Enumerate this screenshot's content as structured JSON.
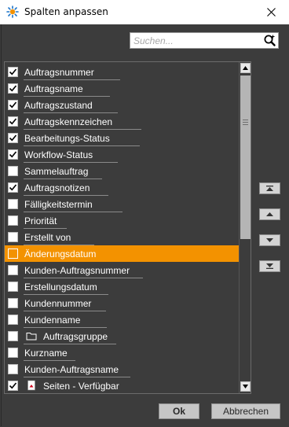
{
  "window": {
    "title": "Spalten anpassen"
  },
  "search": {
    "placeholder": "Suchen...",
    "value": ""
  },
  "list": {
    "items": [
      {
        "label": "Auftragsnummer",
        "checked": true,
        "selected": false,
        "icon": null
      },
      {
        "label": "Auftragsname",
        "checked": true,
        "selected": false,
        "icon": null
      },
      {
        "label": "Auftragszustand",
        "checked": true,
        "selected": false,
        "icon": null
      },
      {
        "label": "Auftragskennzeichen",
        "checked": true,
        "selected": false,
        "icon": null
      },
      {
        "label": "Bearbeitungs-Status",
        "checked": true,
        "selected": false,
        "icon": null
      },
      {
        "label": "Workflow-Status",
        "checked": true,
        "selected": false,
        "icon": null
      },
      {
        "label": "Sammelauftrag",
        "checked": false,
        "selected": false,
        "icon": null
      },
      {
        "label": "Auftragsnotizen",
        "checked": true,
        "selected": false,
        "icon": null
      },
      {
        "label": "Fälligkeitstermin",
        "checked": false,
        "selected": false,
        "icon": null
      },
      {
        "label": "Priorität",
        "checked": false,
        "selected": false,
        "icon": null
      },
      {
        "label": "Erstellt von",
        "checked": false,
        "selected": false,
        "icon": null
      },
      {
        "label": "Änderungsdatum",
        "checked": false,
        "selected": true,
        "icon": null
      },
      {
        "label": "Kunden-Auftragsnummer",
        "checked": false,
        "selected": false,
        "icon": null
      },
      {
        "label": "Erstellungsdatum",
        "checked": false,
        "selected": false,
        "icon": null
      },
      {
        "label": "Kundennummer",
        "checked": false,
        "selected": false,
        "icon": null
      },
      {
        "label": "Kundenname",
        "checked": false,
        "selected": false,
        "icon": null
      },
      {
        "label": "Auftragsgruppe",
        "checked": false,
        "selected": false,
        "icon": "folder-icon"
      },
      {
        "label": "Kurzname",
        "checked": false,
        "selected": false,
        "icon": null
      },
      {
        "label": "Kunden-Auftragsname",
        "checked": false,
        "selected": false,
        "icon": null
      },
      {
        "label": "Seiten - Verfügbar",
        "checked": true,
        "selected": false,
        "icon": "page-icon"
      }
    ]
  },
  "side_buttons": [
    {
      "name": "move-to-top",
      "icon": "move-top-icon"
    },
    {
      "name": "move-up",
      "icon": "move-up-icon"
    },
    {
      "name": "move-down",
      "icon": "move-down-icon"
    },
    {
      "name": "move-to-bottom",
      "icon": "move-bottom-icon"
    }
  ],
  "buttons": {
    "ok_label": "Ok",
    "cancel_label": "Abbrechen"
  },
  "colors": {
    "background": "#3c3c3c",
    "selection": "#f39200",
    "text": "#ffffff"
  }
}
